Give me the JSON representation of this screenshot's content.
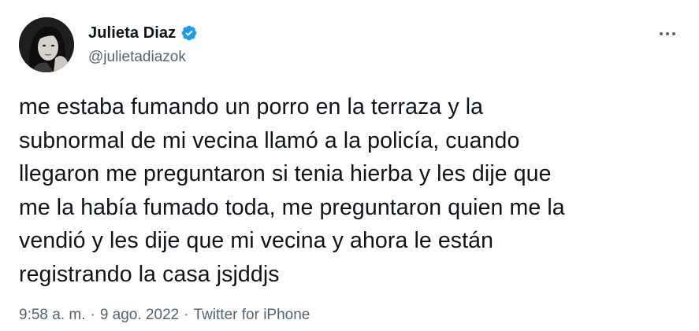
{
  "author": {
    "display_name": "Julieta Diaz",
    "handle": "@julietadiazok",
    "verified": true,
    "avatar_icon": "profile-photo"
  },
  "more_icon": "more-horizontal-icon",
  "tweet": {
    "text": "me estaba fumando un porro en la terraza y la\nsubnormal de mi vecina llamó a la policía, cuando\nllegaron me preguntaron si tenia hierba y les dije que\nme la había fumado toda, me preguntaron quien me la\nvendió y les dije que mi vecina y ahora le están\nregistrando la casa jsjddjs"
  },
  "meta": {
    "time": "9:58 a. m.",
    "separator": "·",
    "date": "9 ago. 2022",
    "source": "Twitter for iPhone"
  },
  "colors": {
    "text_primary": "#0f1419",
    "text_secondary": "#536471",
    "verified_blue": "#1d9bf0",
    "background": "#ffffff"
  }
}
